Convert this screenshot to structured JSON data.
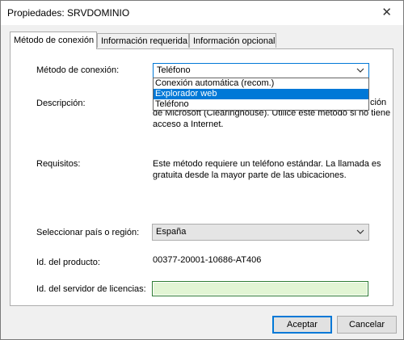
{
  "window": {
    "title": "Propiedades: SRVDOMINIO",
    "close_symbol": "✕"
  },
  "tabs": [
    {
      "label": "Método de conexión"
    },
    {
      "label": "Información requerida"
    },
    {
      "label": "Información opcional"
    }
  ],
  "connection": {
    "label": "Método de conexión:",
    "selected": "Teléfono",
    "options": [
      "Conexión automática (recom.)",
      "Explorador web",
      "Teléfono"
    ],
    "highlighted_option": "Explorador web"
  },
  "description": {
    "label": "Descripción:",
    "hidden_line_end": "ción",
    "line2": "de Microsoft (Clearinghouse). Utilice este método si no tiene",
    "line3": "acceso a Internet."
  },
  "requirements": {
    "label": "Requisitos:",
    "text": "Este método requiere un teléfono estándar. La llamada es gratuita desde la mayor parte de las ubicaciones."
  },
  "country": {
    "label": "Seleccionar país o región:",
    "value": "España"
  },
  "product_id": {
    "label": "Id. del producto:",
    "value": "00377-20001-10686-AT406"
  },
  "license_server": {
    "label": "Id. del servidor de licencias:",
    "value": ""
  },
  "buttons": {
    "ok": "Aceptar",
    "cancel": "Cancelar"
  },
  "colors": {
    "selection": "#0078d7",
    "license_field_bg": "#e2f5d4",
    "license_field_border": "#2e7d32"
  }
}
